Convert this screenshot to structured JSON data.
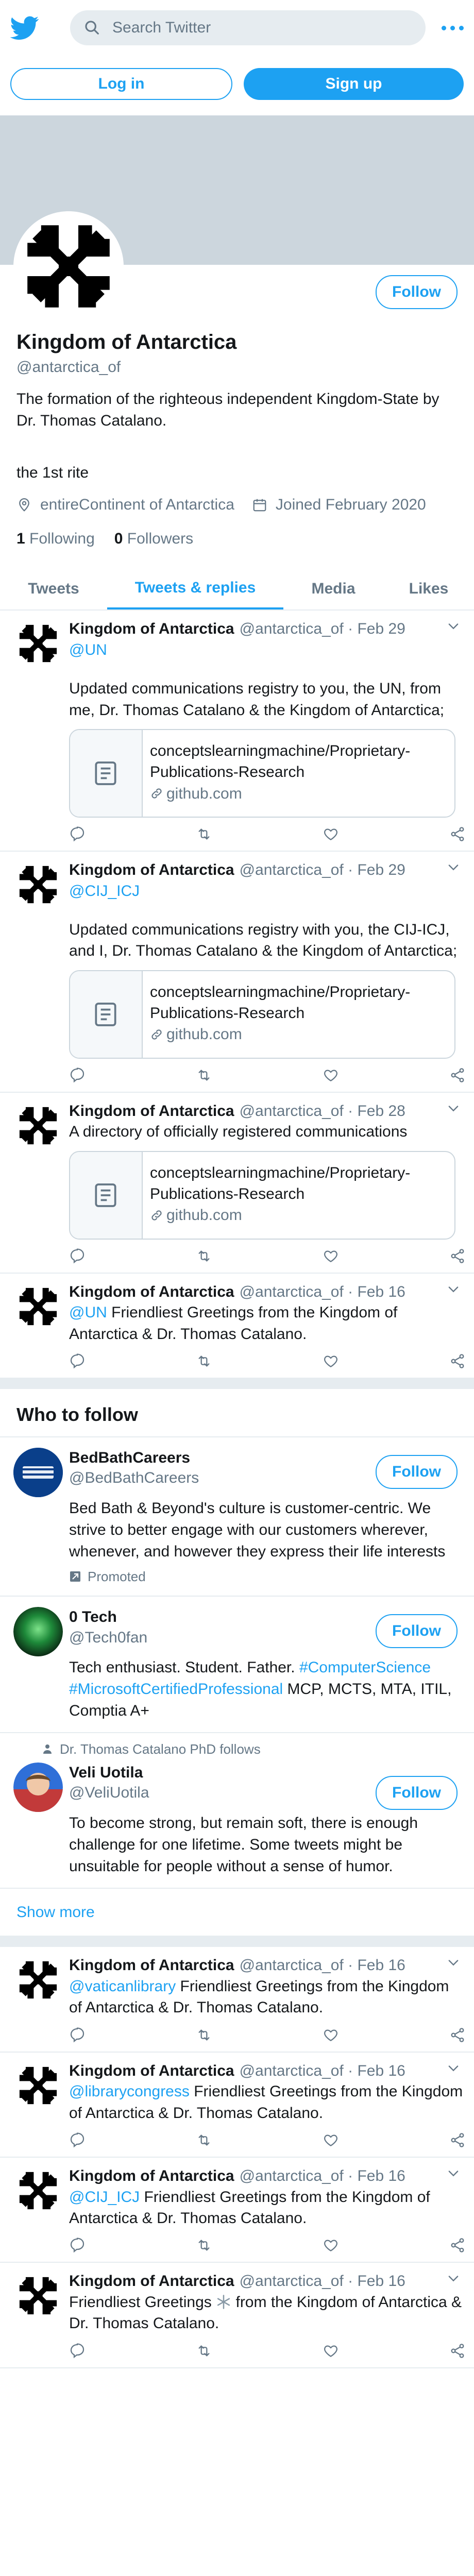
{
  "nav": {
    "search_placeholder": "Search Twitter"
  },
  "auth": {
    "login": "Log in",
    "signup": "Sign up"
  },
  "profile": {
    "name": "Kingdom of Antarctica",
    "handle": "@antarctica_of",
    "bio": "The formation of the righteous independent Kingdom-State by Dr. Thomas Catalano.",
    "rite": "the 1st rite",
    "location": "entireContinent of Antarctica",
    "joined": "Joined February 2020",
    "following_count": "1",
    "following_label": "Following",
    "followers_count": "0",
    "followers_label": "Followers",
    "follow_label": "Follow"
  },
  "tabs": [
    "Tweets",
    "Tweets & replies",
    "Media",
    "Likes"
  ],
  "tweets": [
    {
      "name": "Kingdom of Antarctica",
      "meta": "@antarctica_of · Feb 29",
      "mention": "@UN",
      "text": "Updated communications registry to you, the UN, from me, Dr. Thomas Catalano & the Kingdom of Antarctica;",
      "card_title": "conceptslearningmachine/Proprietary-Publications-Research",
      "card_domain": "github.com"
    },
    {
      "name": "Kingdom of Antarctica",
      "meta": "@antarctica_of · Feb 29",
      "mention": "@CIJ_ICJ",
      "text": "Updated communications registry with you, the CIJ-ICJ, and I, Dr. Thomas Catalano & the Kingdom of Antarctica;",
      "card_title": "conceptslearningmachine/Proprietary-Publications-Research",
      "card_domain": "github.com"
    },
    {
      "name": "Kingdom of Antarctica",
      "meta": "@antarctica_of · Feb 28",
      "text": "A directory of officially registered communications",
      "card_title": "conceptslearningmachine/Proprietary-Publications-Research",
      "card_domain": "github.com"
    },
    {
      "name": "Kingdom of Antarctica",
      "meta": "@antarctica_of · Feb 16",
      "mention": "@UN",
      "text": "Friendliest Greetings from the Kingdom of Antarctica & Dr. Thomas Catalano."
    }
  ],
  "who_to_follow": {
    "title": "Who to follow",
    "users": [
      {
        "name": "BedBathCareers",
        "handle": "@BedBathCareers",
        "bio": "Bed Bath & Beyond's culture is customer-centric. We strive to better engage with our customers wherever, whenever, and however they express their life interests",
        "promoted": "Promoted"
      },
      {
        "name": "0 Tech",
        "handle": "@Tech0fan",
        "bio_plain": "Tech enthusiast. Student. Father. ",
        "bio_tag1": "#ComputerScience",
        "bio_tag2": "#MicrosoftCertifiedProfessional",
        "bio_tail": " MCP, MCTS, MTA, ITIL, Comptia A+"
      },
      {
        "context": "Dr. Thomas Catalano PhD follows",
        "name": "Veli Uotila",
        "handle": "@VeliUotila",
        "bio": "To become strong, but remain soft, there is enough challenge for one lifetime. Some tweets might be unsuitable for people without a sense of humor."
      }
    ],
    "show_more": "Show more"
  },
  "tweets2": [
    {
      "name": "Kingdom of Antarctica",
      "meta": "@antarctica_of · Feb 16",
      "mention": "@vaticanlibrary",
      "text": "Friendliest Greetings from the Kingdom of Antarctica & Dr. Thomas Catalano."
    },
    {
      "name": "Kingdom of Antarctica",
      "meta": "@antarctica_of · Feb 16",
      "mention": "@librarycongress",
      "text": "Friendliest Greetings from the Kingdom of Antarctica & Dr. Thomas Catalano."
    },
    {
      "name": "Kingdom of Antarctica",
      "meta": "@antarctica_of · Feb 16",
      "mention": "@CIJ_ICJ",
      "text": "Friendliest Greetings from the Kingdom of Antarctica & Dr. Thomas Catalano."
    },
    {
      "name": "Kingdom of Antarctica",
      "meta": "@antarctica_of · Feb 16",
      "text_a": "Friendliest Greetings",
      "text_b": "from the Kingdom of Antarctica & Dr. Thomas Catalano."
    }
  ],
  "colors": {
    "accent": "#1da1f2",
    "muted": "#657786",
    "divider": "#e6ecf0",
    "banner": "#ccd6dd"
  }
}
